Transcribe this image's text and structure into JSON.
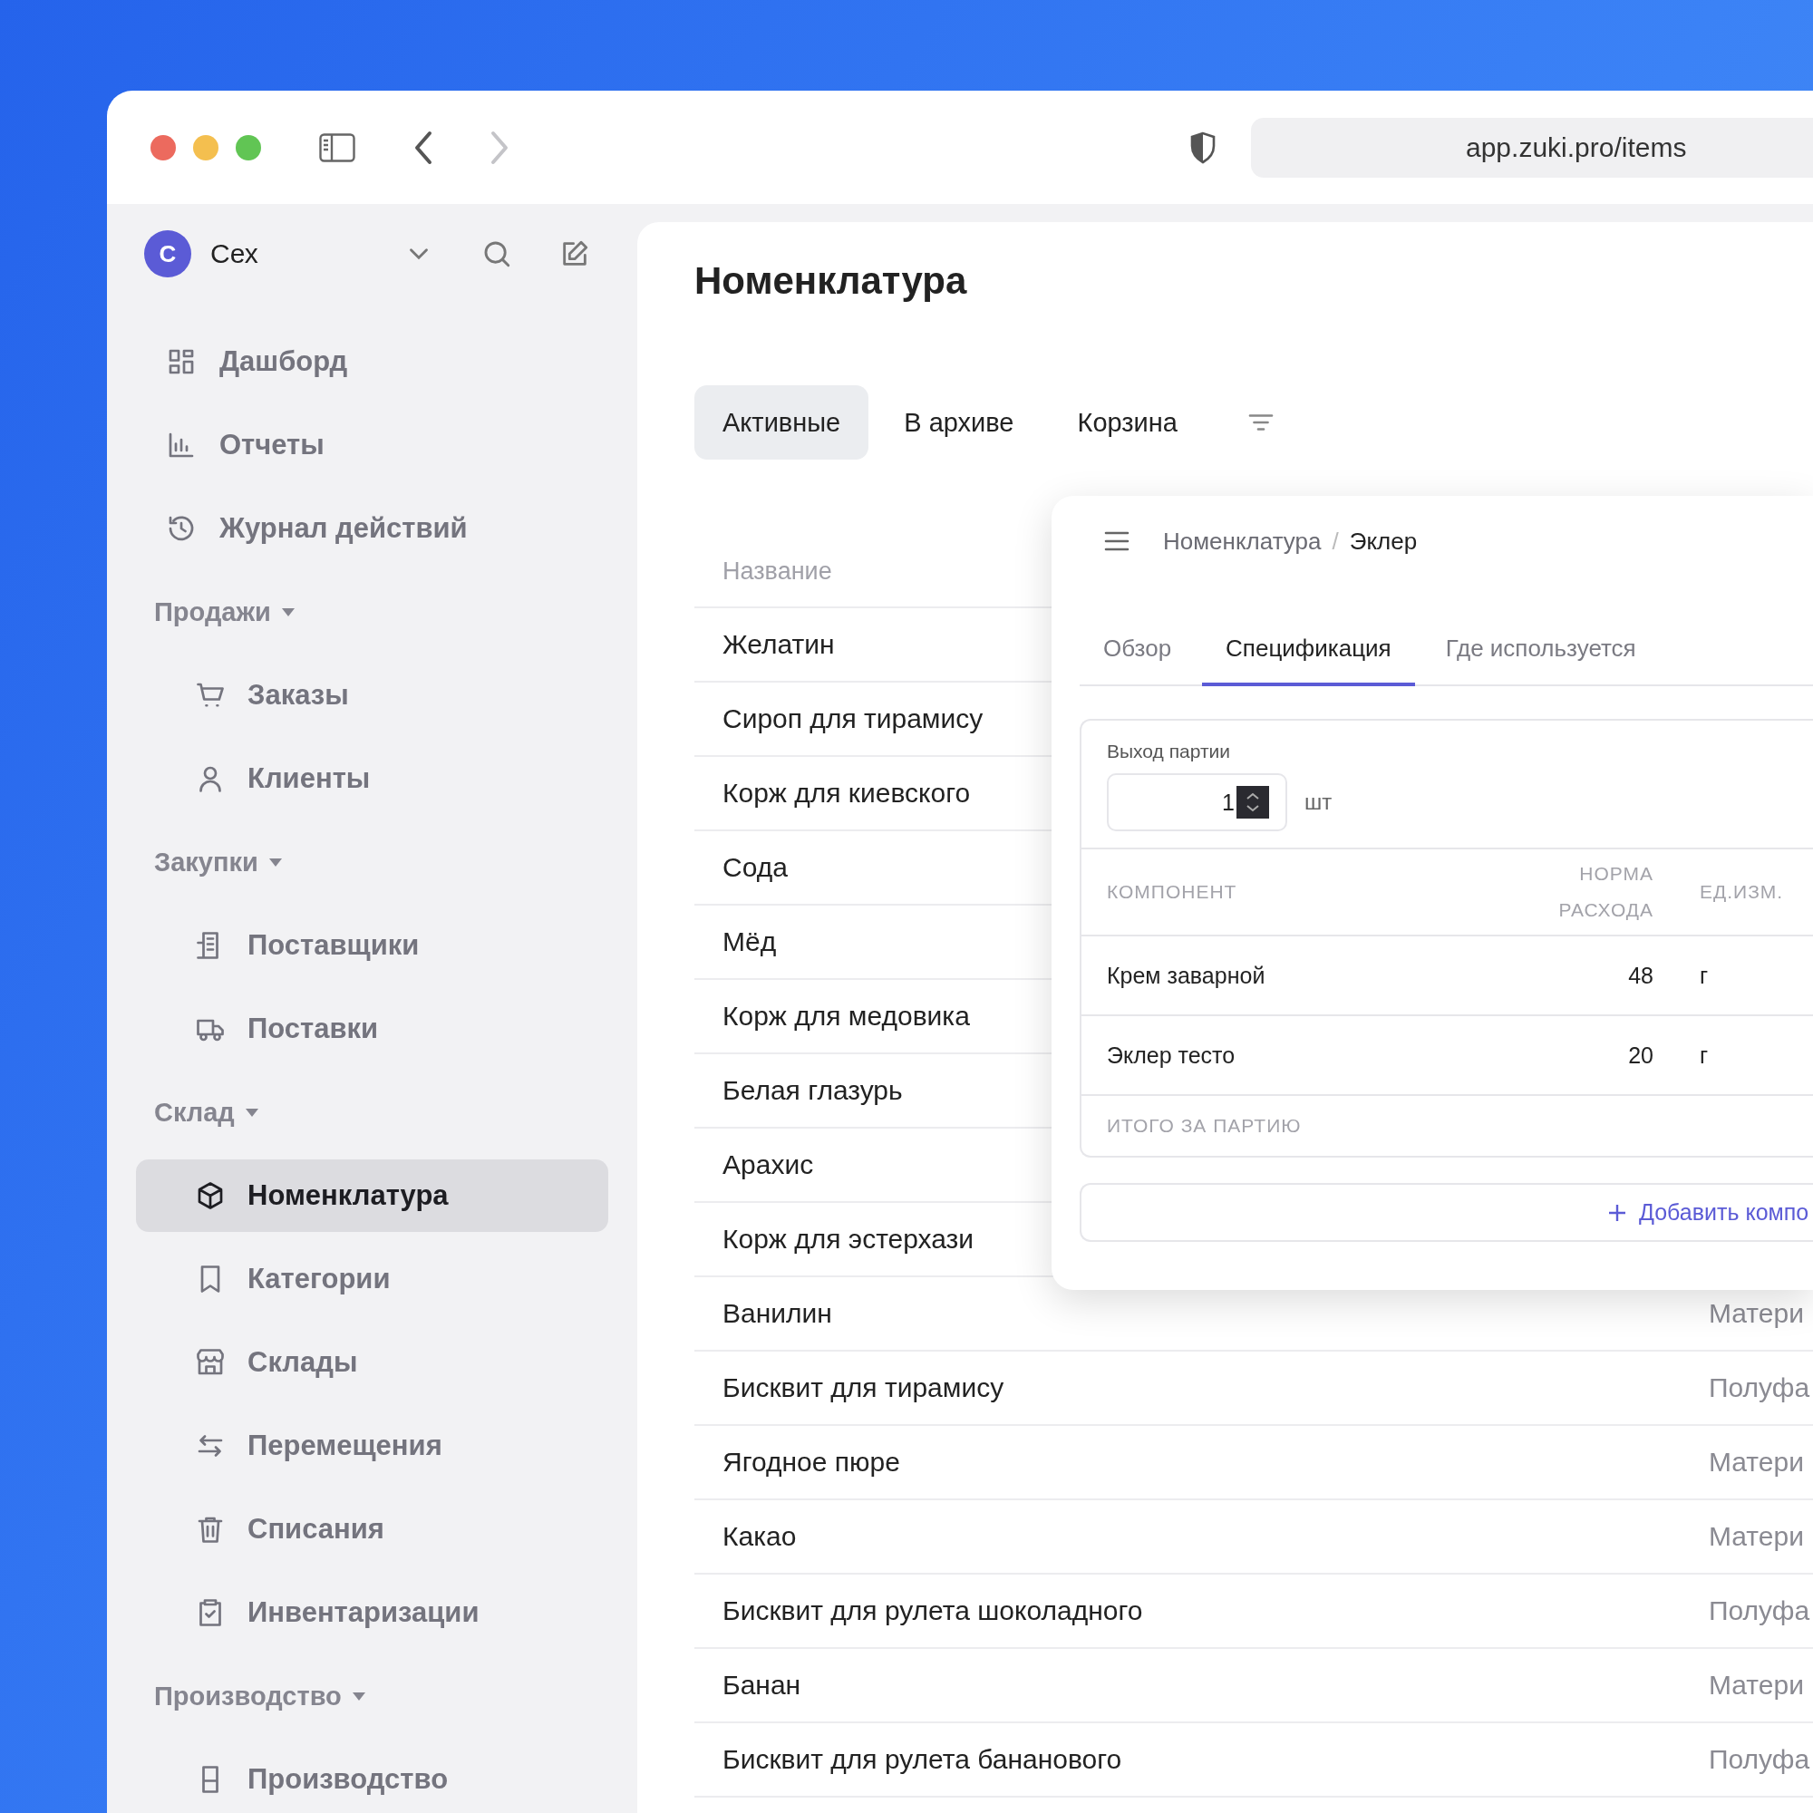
{
  "browser": {
    "url": "app.zuki.pro/items",
    "back": {
      "disabled": false
    },
    "forward": {
      "disabled": true
    }
  },
  "sidebar": {
    "workspace": {
      "initial": "С",
      "name": "Сех"
    },
    "items": [
      {
        "label": "Дашборд",
        "selected": false
      },
      {
        "label": "Отчеты",
        "selected": false
      },
      {
        "label": "Журнал действий",
        "selected": false
      }
    ],
    "sections": [
      {
        "title": "Продажи",
        "expanded": true,
        "items": [
          {
            "label": "Заказы",
            "selected": false
          },
          {
            "label": "Клиенты",
            "selected": false
          }
        ]
      },
      {
        "title": "Закупки",
        "expanded": true,
        "items": [
          {
            "label": "Поставщики",
            "selected": false
          },
          {
            "label": "Поставки",
            "selected": false
          }
        ]
      },
      {
        "title": "Склад",
        "expanded": true,
        "items": [
          {
            "label": "Номенклатура",
            "selected": true
          },
          {
            "label": "Категории",
            "selected": false
          },
          {
            "label": "Склады",
            "selected": false
          },
          {
            "label": "Перемещения",
            "selected": false
          },
          {
            "label": "Списания",
            "selected": false
          },
          {
            "label": "Инвентаризации",
            "selected": false
          }
        ]
      },
      {
        "title": "Производство",
        "expanded": true,
        "items": [
          {
            "label": "Производство",
            "selected": false
          }
        ]
      }
    ]
  },
  "main": {
    "title": "Номенклатура",
    "tabs": [
      {
        "label": "Активные",
        "selected": true
      },
      {
        "label": "В архиве",
        "selected": false
      },
      {
        "label": "Корзина",
        "selected": false
      }
    ],
    "table": {
      "columns": [
        "Название"
      ],
      "rows": [
        {
          "name": "Желатин"
        },
        {
          "name": "Сироп для тирамису"
        },
        {
          "name": "Корж для киевского"
        },
        {
          "name": "Сода"
        },
        {
          "name": "Мёд"
        },
        {
          "name": "Корж для медовика"
        },
        {
          "name": "Белая глазурь"
        },
        {
          "name": "Арахис"
        },
        {
          "name": "Корж для эстерхази"
        },
        {
          "name": "Ванилин",
          "type": "Матери"
        },
        {
          "name": "Бисквит для тирамису",
          "type": "Полуфа"
        },
        {
          "name": "Ягодное пюре",
          "type": "Матери"
        },
        {
          "name": "Какао",
          "type": "Матери"
        },
        {
          "name": "Бисквит для рулета шоколадного",
          "type": "Полуфа"
        },
        {
          "name": "Банан",
          "type": "Матери"
        },
        {
          "name": "Бисквит для рулета бананового",
          "type": "Полуфа"
        }
      ]
    }
  },
  "panel": {
    "breadcrumb": {
      "items": [
        "Номенклатура",
        "Эклер"
      ],
      "separator": "/"
    },
    "tabs": [
      {
        "label": "Обзор",
        "selected": false
      },
      {
        "label": "Спецификация",
        "selected": true
      },
      {
        "label": "Где используется",
        "selected": false
      }
    ],
    "yield": {
      "label": "Выход партии",
      "value": "1",
      "unit": "шт"
    },
    "spec": {
      "columns": [
        "КОМПОНЕНТ",
        "НОРМА РАСХОДА",
        "ЕД.ИЗМ."
      ],
      "rows": [
        {
          "component": "Крем заварной",
          "amount": "48",
          "unit": "г"
        },
        {
          "component": "Эклер тесто",
          "amount": "20",
          "unit": "г"
        }
      ],
      "total_label": "ИТОГО ЗА ПАРТИЮ"
    },
    "add_button": "Добавить компо"
  }
}
